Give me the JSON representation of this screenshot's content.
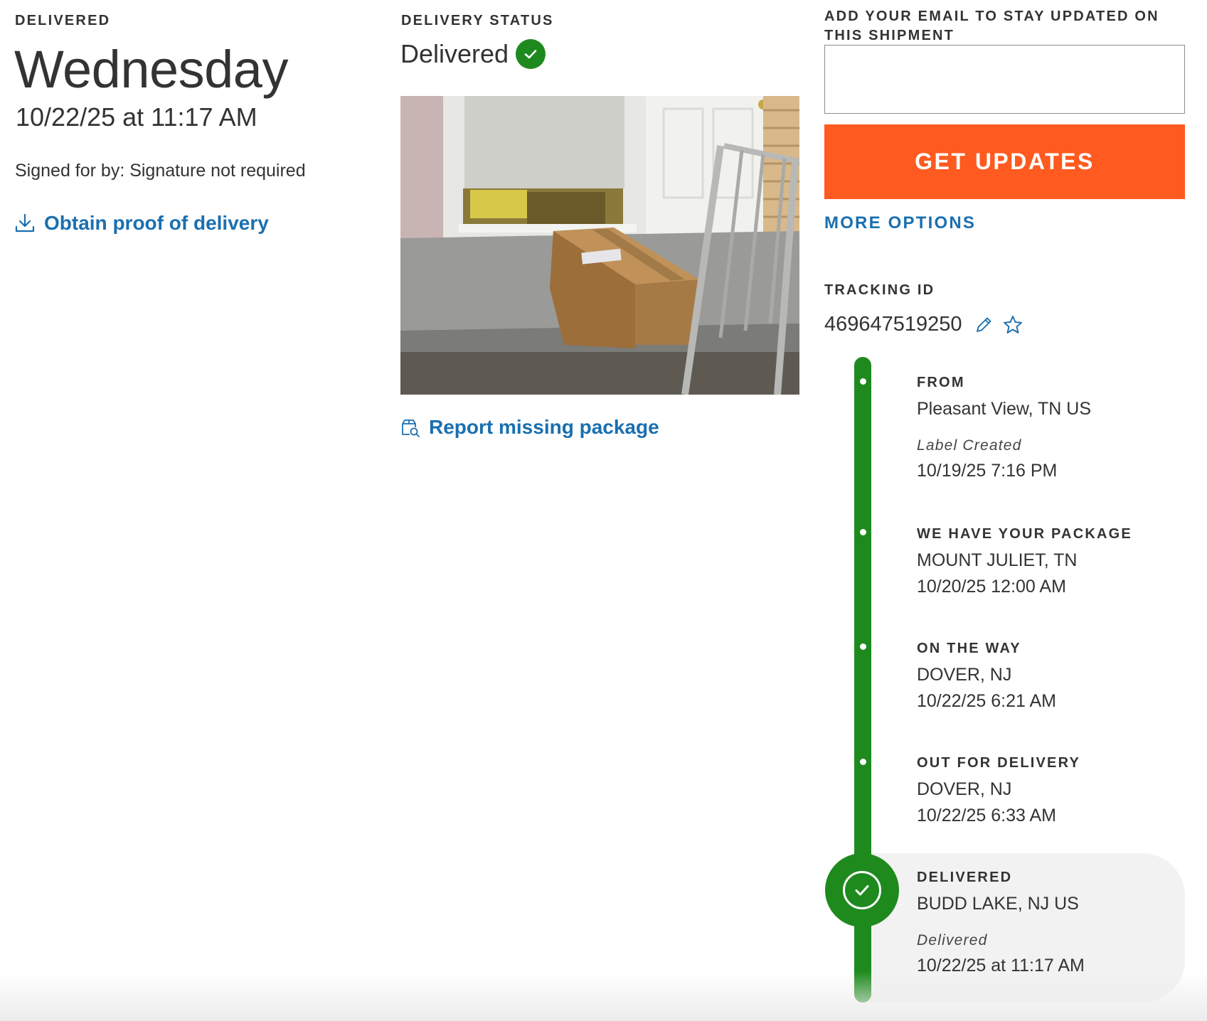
{
  "delivered_summary": {
    "eyebrow": "DELIVERED",
    "day": "Wednesday",
    "date_time": "10/22/25 at 11:17 AM",
    "signed_for": "Signed for by: Signature not required",
    "proof_link": "Obtain proof of delivery"
  },
  "delivery_status": {
    "eyebrow": "DELIVERY STATUS",
    "status": "Delivered",
    "report_link": "Report missing package"
  },
  "updates": {
    "heading_line1": "ADD YOUR EMAIL TO STAY UPDATED ON",
    "heading_line2": "THIS SHIPMENT",
    "email_value": "",
    "button_label": "GET UPDATES",
    "more_options": "MORE OPTIONS"
  },
  "tracking": {
    "label": "TRACKING ID",
    "id": "469647519250"
  },
  "timeline": [
    {
      "title": "FROM",
      "location": "Pleasant View, TN US",
      "note": "Label Created",
      "datetime": "10/19/25 7:16 PM"
    },
    {
      "title": "WE HAVE YOUR PACKAGE",
      "location": "MOUNT JULIET, TN",
      "datetime": "10/20/25 12:00 AM"
    },
    {
      "title": "ON THE WAY",
      "location": "DOVER, NJ",
      "datetime": "10/22/25 6:21 AM"
    },
    {
      "title": "OUT FOR DELIVERY",
      "location": "DOVER, NJ",
      "datetime": "10/22/25 6:33 AM"
    },
    {
      "title": "DELIVERED",
      "location": "BUDD LAKE, NJ US",
      "note": "Delivered",
      "datetime": "10/22/25 at 11:17 AM"
    }
  ],
  "colors": {
    "accent_orange": "#ff5a1f",
    "link_blue": "#1a6fb0",
    "success_green": "#1e8a1e"
  },
  "icons": {
    "proof": "download-icon",
    "status": "check-circle-icon",
    "report": "package-search-icon",
    "edit": "pencil-icon",
    "favorite": "star-icon"
  }
}
